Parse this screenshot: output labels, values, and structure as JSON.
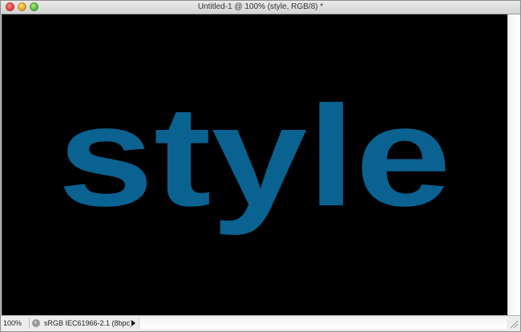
{
  "window": {
    "title": "Untitled-1 @ 100% (style, RGB/8) *"
  },
  "canvas": {
    "background_color": "#000000",
    "text": "style",
    "text_color": "#0a6291"
  },
  "status_bar": {
    "zoom": "100%",
    "document_info": "sRGB IEC61966-2.1 (8bpc)",
    "info_icon": "document-info-icon"
  }
}
